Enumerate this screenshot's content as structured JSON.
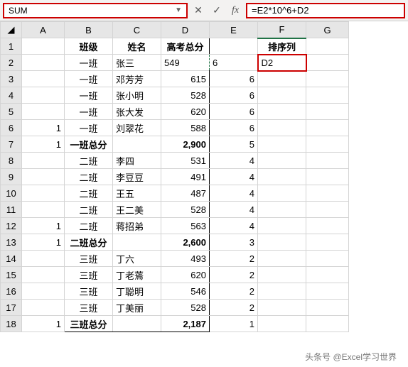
{
  "namebox": {
    "value": "SUM"
  },
  "formula": "=E2*10^6+D2",
  "cols": [
    "A",
    "B",
    "C",
    "D",
    "E",
    "F",
    "G"
  ],
  "headers": {
    "B": "班级",
    "C": "姓名",
    "D": "高考总分",
    "F": "排序列"
  },
  "rows": [
    {
      "n": 2,
      "B": "一班",
      "C": "张三",
      "D": "549",
      "E": "6",
      "F": "D2",
      "active": true
    },
    {
      "n": 3,
      "B": "一班",
      "C": "邓芳芳",
      "D": "615",
      "E": "6"
    },
    {
      "n": 4,
      "B": "一班",
      "C": "张小明",
      "D": "528",
      "E": "6"
    },
    {
      "n": 5,
      "B": "一班",
      "C": "张大发",
      "D": "620",
      "E": "6"
    },
    {
      "n": 6,
      "A": "1",
      "B": "一班",
      "C": "刘翠花",
      "D": "588",
      "E": "6"
    },
    {
      "n": 7,
      "A": "1",
      "B": "一班总分",
      "D": "2,900",
      "E": "5",
      "bold": true
    },
    {
      "n": 8,
      "B": "二班",
      "C": "李四",
      "D": "531",
      "E": "4"
    },
    {
      "n": 9,
      "B": "二班",
      "C": "李豆豆",
      "D": "491",
      "E": "4"
    },
    {
      "n": 10,
      "B": "二班",
      "C": "王五",
      "D": "487",
      "E": "4"
    },
    {
      "n": 11,
      "B": "二班",
      "C": "王二美",
      "D": "528",
      "E": "4"
    },
    {
      "n": 12,
      "A": "1",
      "B": "二班",
      "C": "蒋招弟",
      "D": "563",
      "E": "4"
    },
    {
      "n": 13,
      "A": "1",
      "B": "二班总分",
      "D": "2,600",
      "E": "3",
      "bold": true
    },
    {
      "n": 14,
      "B": "三班",
      "C": "丁六",
      "D": "493",
      "E": "2"
    },
    {
      "n": 15,
      "B": "三班",
      "C": "丁老蔫",
      "D": "620",
      "E": "2"
    },
    {
      "n": 16,
      "B": "三班",
      "C": "丁聪明",
      "D": "546",
      "E": "2"
    },
    {
      "n": 17,
      "B": "三班",
      "C": "丁美丽",
      "D": "528",
      "E": "2"
    },
    {
      "n": 18,
      "A": "1",
      "B": "三班总分",
      "D": "2,187",
      "E": "1",
      "bold": true,
      "last": true
    }
  ],
  "watermark": "头条号 @Excel学习世界"
}
